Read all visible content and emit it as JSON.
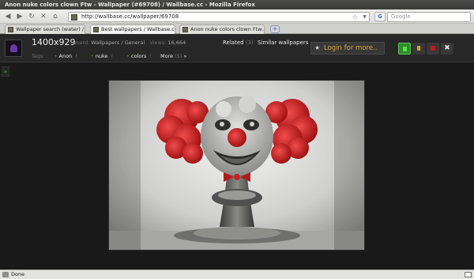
{
  "window": {
    "title": "Anon nuke colors clown Ftw - Wallpaper (#69708) / Wallbase.cc - Mozilla Firefox"
  },
  "nav": {
    "back_icon": "back-arrow-icon",
    "forward_icon": "forward-arrow-icon",
    "reload_icon": "reload-icon",
    "stop_icon": "stop-icon",
    "home_icon": "home-icon",
    "url": "http://wallbase.cc/wallpaper/69708",
    "search_engine": "G",
    "search_placeholder": "Google"
  },
  "tabs": [
    {
      "label": "Wallpaper search (water) / ...",
      "active": false
    },
    {
      "label": "Best wallpapers / Wallbase.cc",
      "active": true
    },
    {
      "label": "Anon nuke colors clown Ftw...",
      "active": false
    }
  ],
  "new_tab_label": "+",
  "header": {
    "resolution": "1400x929",
    "board_label": "Board:",
    "board_value": "Wallpapers / General",
    "views_label": "Views:",
    "views_value": "16,664",
    "tags_label": "Tags:",
    "tags": [
      "Anon",
      "nuke",
      "colors"
    ],
    "tag_remove_label": "!",
    "more_label": "More",
    "more_count": "(5)",
    "more_arrow": "»",
    "related_label": "Related",
    "related_count": "(3)",
    "similar_label": "Similar wallpapers",
    "login_label": "Login for more..",
    "close_label": "✖"
  },
  "sidebar_toggle": "»",
  "status": {
    "text": "Done"
  },
  "colors": {
    "accent_green": "#2e8b2a",
    "login_orange": "#d6a437",
    "flag_red": "#c01c1c"
  }
}
